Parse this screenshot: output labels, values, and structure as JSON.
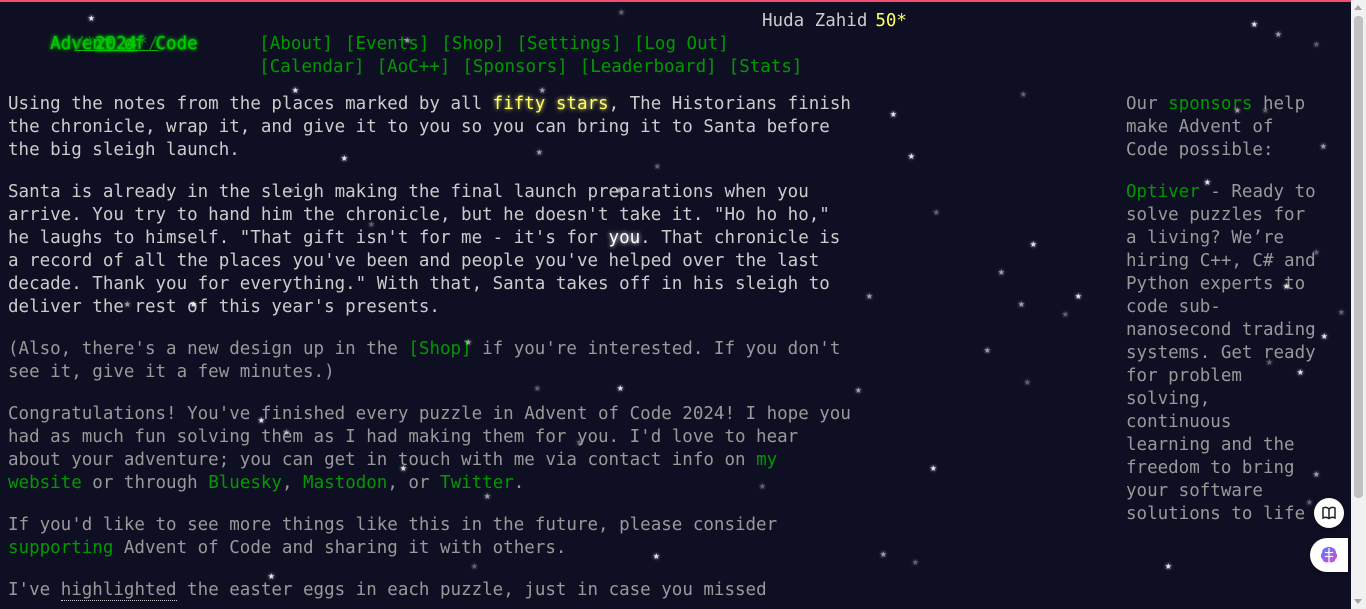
{
  "header": {
    "title": "Advent of Code",
    "year_prefix": "/*",
    "year": "2024",
    "year_suffix": "*/",
    "nav_row1": [
      "[About]",
      "[Events]",
      "[Shop]",
      "[Settings]",
      "[Log Out]"
    ],
    "nav_row2": [
      "[Calendar]",
      "[AoC++]",
      "[Sponsors]",
      "[Leaderboard]",
      "[Stats]"
    ],
    "user_name": "Huda Zahid",
    "star_count": "50*"
  },
  "main": {
    "p1_a": "Using the notes from the places marked by all ",
    "p1_em": "fifty stars",
    "p1_b": ", The Historians finish the chronicle, wrap it, and give it to you so you can bring it to Santa before the big sleigh launch.",
    "p2_a": "Santa is already in the sleigh making the final launch preparations when you arrive. You try to hand him the chronicle, but he doesn't take it. \"Ho ho ho,\" he laughs to himself. \"That gift isn't for me - it's for ",
    "p2_em": "you",
    "p2_b": ". That chronicle is a record of all the places you've been and people you've helped over the last decade. Thank you for everything.\" With that, Santa takes off in his sleigh to deliver the rest of this year's presents.",
    "p3_a": "(Also, there's a new design up in the ",
    "p3_link": "[Shop]",
    "p3_b": " if you're interested. If you don't see it, give it a few minutes.)",
    "p4_a": "Congratulations! You've finished every puzzle in Advent of Code 2024! I hope you had as much fun solving them as I had making them for you. I'd love to hear about your adventure; you can get in touch with me via contact info on ",
    "p4_link1": "my website",
    "p4_b": " or through ",
    "p4_link2": "Bluesky",
    "p4_c": ", ",
    "p4_link3": "Mastodon",
    "p4_d": ", or ",
    "p4_link4": "Twitter",
    "p4_e": ".",
    "p5_a": "If you'd like to see more things like this in the future, please consider ",
    "p5_link": "supporting",
    "p5_b": " Advent of Code and sharing it with others.",
    "p6_a": "I've ",
    "p6_hl": "highlighted",
    "p6_b": " the easter eggs in each puzzle, just in case you missed"
  },
  "sidebar": {
    "intro_a": "Our ",
    "intro_link": "sponsors",
    "intro_b": " help make Advent of Code possible:",
    "sponsor_name": "Optiver",
    "sponsor_text": " - Ready to solve puzzles for a living? We’re hiring C++, C# and Python experts to code sub-nanosecond trading systems. Get ready for problem solving, continuous learning and the freedom to bring your software solutions to life"
  },
  "icons": {
    "book": "book-icon",
    "brain": "brain-icon"
  },
  "colors": {
    "background": "#0f0f23",
    "text": "#cccccc",
    "link": "#009900",
    "title": "#00cc00",
    "star": "#ffff66",
    "top_line": "#f0506e"
  }
}
